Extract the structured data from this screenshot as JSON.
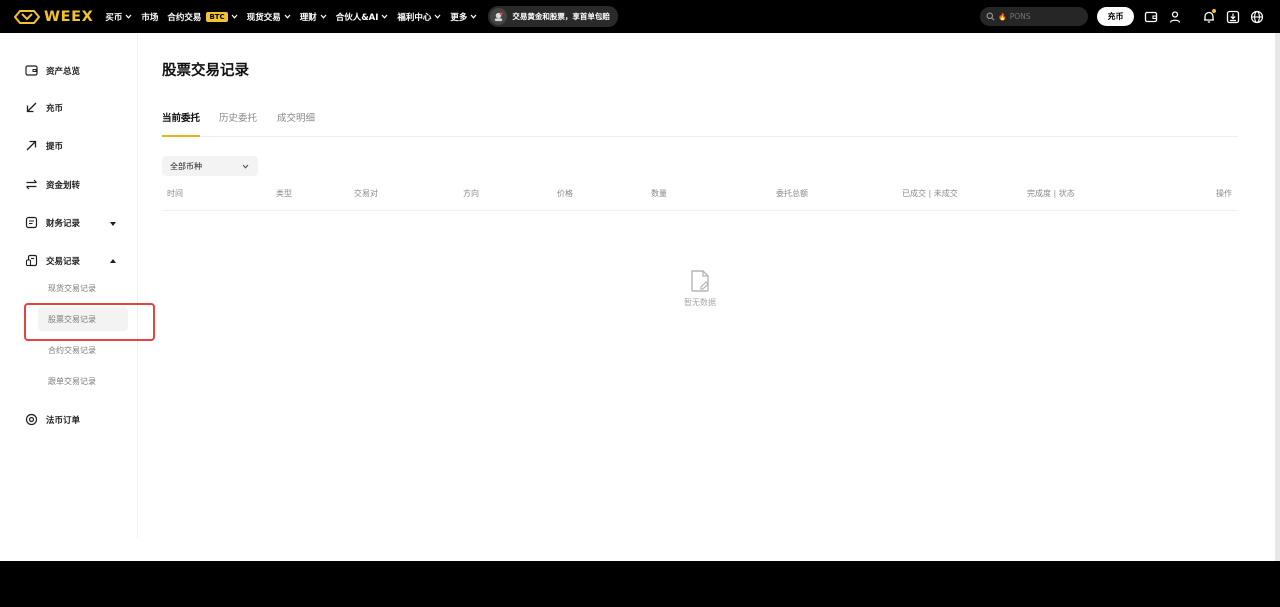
{
  "brand": {
    "name": "WEEX",
    "accent": "#f2c230",
    "highlight": "#e5433f"
  },
  "nav": {
    "items": [
      {
        "label": "买币",
        "has_chevron": true
      },
      {
        "label": "市场",
        "has_chevron": false
      },
      {
        "label": "合约交易",
        "badge": "BTC",
        "has_chevron": true
      },
      {
        "label": "现货交易",
        "has_chevron": true
      },
      {
        "label": "理财",
        "has_chevron": true
      },
      {
        "label": "合伙人&AI",
        "has_chevron": true
      },
      {
        "label": "福利中心",
        "has_chevron": true
      },
      {
        "label": "更多",
        "has_chevron": true
      }
    ],
    "promo": "交易黄金和股票，享首单包赔"
  },
  "search": {
    "placeholder": "PONS",
    "icon": "search-icon",
    "hot_icon": "fire-icon"
  },
  "header_actions": {
    "deposit_label": "充币",
    "icons": [
      "wallet-icon",
      "user-icon",
      "bell-icon",
      "download-icon",
      "globe-icon"
    ]
  },
  "sidebar": {
    "items": [
      {
        "label": "资产总览",
        "icon": "wallet-icon"
      },
      {
        "label": "充币",
        "icon": "arrow-down-left-icon"
      },
      {
        "label": "提币",
        "icon": "arrow-up-right-icon"
      },
      {
        "label": "资金划转",
        "icon": "transfer-icon"
      },
      {
        "label": "财务记录",
        "icon": "document-icon",
        "expanded": false
      },
      {
        "label": "交易记录",
        "icon": "records-icon",
        "expanded": true
      },
      {
        "label": "法币订单",
        "icon": "fiat-icon"
      }
    ],
    "trade_records_sub": [
      {
        "label": "现货交易记录",
        "active": false
      },
      {
        "label": "股票交易记录",
        "active": true
      },
      {
        "label": "合约交易记录",
        "active": false
      },
      {
        "label": "跟单交易记录",
        "active": false
      }
    ]
  },
  "page": {
    "title": "股票交易记录",
    "tabs": [
      {
        "label": "当前委托",
        "active": true
      },
      {
        "label": "历史委托",
        "active": false
      },
      {
        "label": "成交明细",
        "active": false
      }
    ],
    "filter": {
      "selected": "全部币种"
    },
    "table": {
      "columns": [
        "时间",
        "类型",
        "交易对",
        "方向",
        "价格",
        "数量",
        "委托总额",
        "已成交 | 未成交",
        "完成度 | 状态",
        "操作"
      ],
      "rows": []
    },
    "empty_text": "暂无数据"
  }
}
